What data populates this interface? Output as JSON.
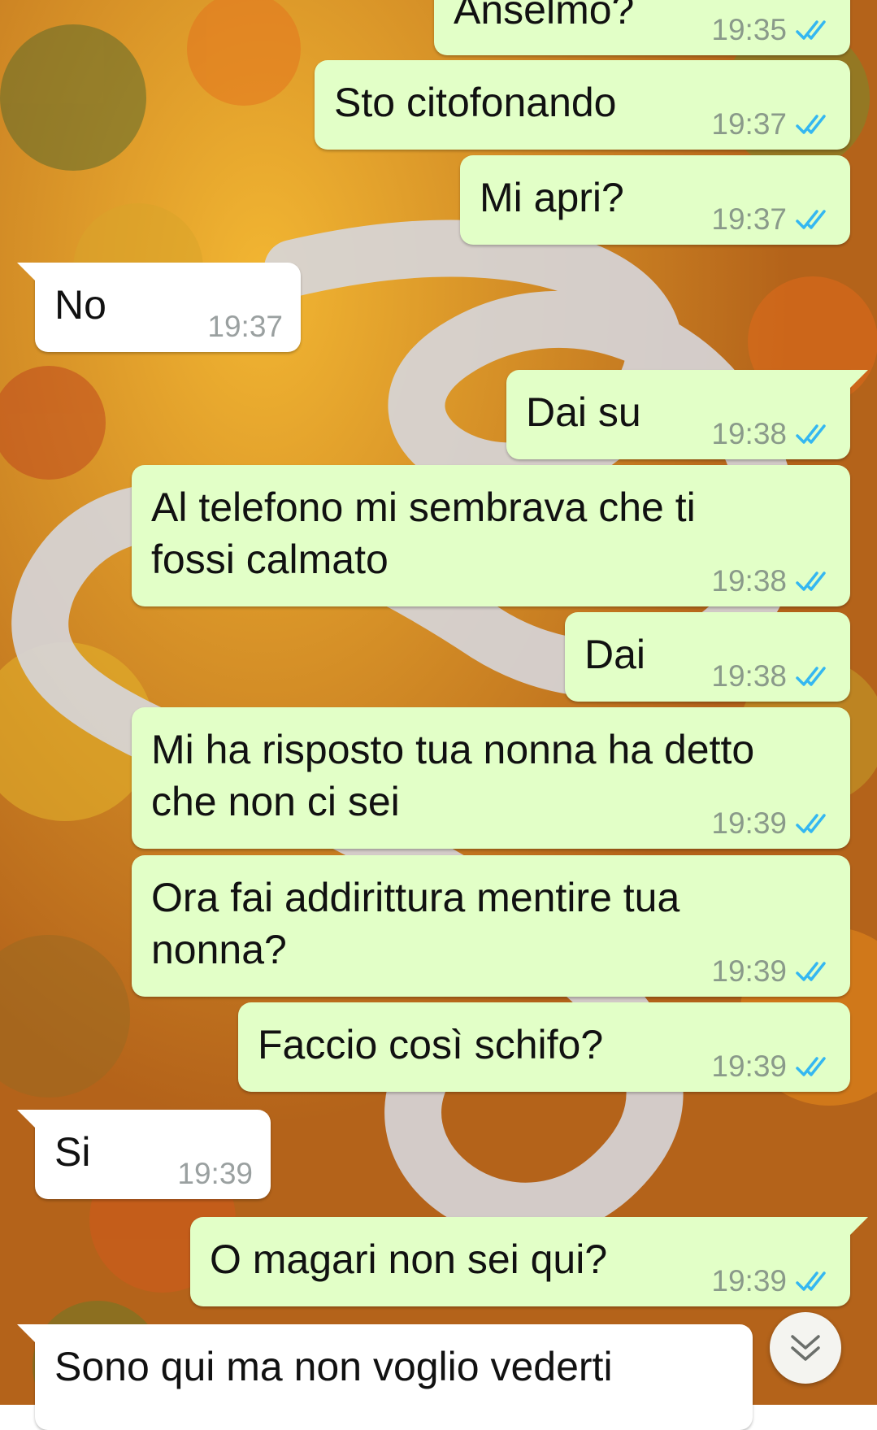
{
  "colors": {
    "outgoing_bubble": "#e2ffc7",
    "incoming_bubble": "#ffffff",
    "read_ticks": "#34b7f1",
    "timestamp": "#8a9a8a"
  },
  "messages": [
    {
      "direction": "out",
      "text": "Anselmo?",
      "time": "19:35",
      "status": "read",
      "status_icon": "double-check-icon"
    },
    {
      "direction": "out",
      "text": "Sto citofonando",
      "time": "19:37",
      "status": "read",
      "status_icon": "double-check-icon"
    },
    {
      "direction": "out",
      "text": "Mi apri?",
      "time": "19:37",
      "status": "read",
      "status_icon": "double-check-icon"
    },
    {
      "direction": "in",
      "text": "No",
      "time": "19:37"
    },
    {
      "direction": "out",
      "text": "Dai su",
      "time": "19:38",
      "status": "read",
      "status_icon": "double-check-icon"
    },
    {
      "direction": "out",
      "text": "Al telefono mi sembrava che ti\nfossi calmato",
      "time": "19:38",
      "status": "read",
      "status_icon": "double-check-icon"
    },
    {
      "direction": "out",
      "text": "Dai",
      "time": "19:38",
      "status": "read",
      "status_icon": "double-check-icon"
    },
    {
      "direction": "out",
      "text": "Mi ha risposto tua nonna ha detto\nche non ci sei",
      "time": "19:39",
      "status": "read",
      "status_icon": "double-check-icon"
    },
    {
      "direction": "out",
      "text": "Ora fai addirittura mentire tua\nnonna?",
      "time": "19:39",
      "status": "read",
      "status_icon": "double-check-icon"
    },
    {
      "direction": "out",
      "text": "Faccio così schifo?",
      "time": "19:39",
      "status": "read",
      "status_icon": "double-check-icon"
    },
    {
      "direction": "in",
      "text": "Si",
      "time": "19:39"
    },
    {
      "direction": "out",
      "text": "O magari non sei qui?",
      "time": "19:39",
      "status": "read",
      "status_icon": "double-check-icon"
    },
    {
      "direction": "in",
      "text": "Sono qui ma non voglio vederti",
      "time": ""
    }
  ],
  "scroll_button": {
    "icon": "double-chevron-down-icon"
  },
  "wallpaper": {
    "description_icon": "autumn-road-wallpaper"
  }
}
